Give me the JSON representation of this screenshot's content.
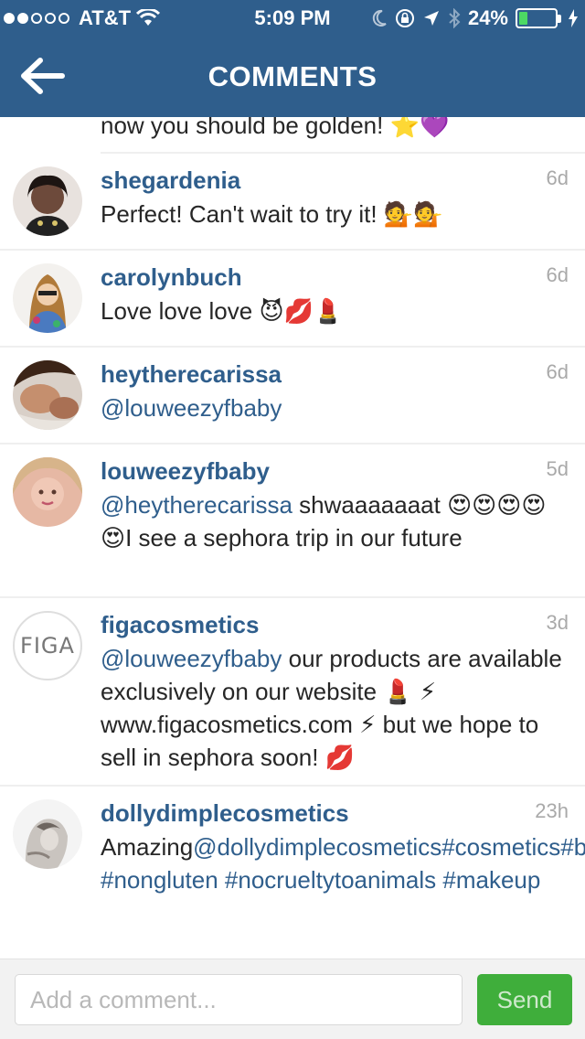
{
  "status_bar": {
    "carrier": "AT&T",
    "time": "5:09 PM",
    "battery_percent": "24%",
    "battery_level": 0.24,
    "signal_dots_filled": 2,
    "signal_dots_total": 5
  },
  "header": {
    "title": "COMMENTS",
    "back_icon": "back-arrow-icon"
  },
  "partial_comment": {
    "text": "now you should be golden! ⭐💜"
  },
  "comments": [
    {
      "username": "shegardenia",
      "time": "6d",
      "parts": [
        {
          "t": "Perfect! Can't wait to try it! 💁💁"
        }
      ]
    },
    {
      "username": "carolynbuch",
      "time": "6d",
      "parts": [
        {
          "t": "Love love love 😈💋💄"
        }
      ]
    },
    {
      "username": "heytherecarissa",
      "time": "6d",
      "parts": [
        {
          "t": "@louweezyfbaby",
          "mention": true
        }
      ]
    },
    {
      "username": "louweezyfbaby",
      "time": "5d",
      "parts": [
        {
          "t": "@heytherecarissa",
          "mention": true
        },
        {
          "t": " shwaaaaaaat 😍😍😍😍😍I see a sephora trip in our future"
        }
      ]
    },
    {
      "username": "figacosmetics",
      "time": "3d",
      "avatar_text": "FIGA",
      "parts": [
        {
          "t": "@louweezyfbaby",
          "mention": true
        },
        {
          "t": " our products are available exclusively on our website 💄 ⚡ www.figacosmetics.com ⚡ but we hope to sell in sephora soon! 💋"
        }
      ]
    },
    {
      "username": "dollydimplecosmetics",
      "time": "23h",
      "parts": [
        {
          "t": "Amazing"
        },
        {
          "t": "@dollydimplecosmetics#cosmetics#beauty#bride#lushlashes #nongluten #nocrueltytoanimals #makeup",
          "mention": true
        }
      ]
    }
  ],
  "footer": {
    "placeholder": "Add a comment...",
    "send_label": "Send"
  },
  "colors": {
    "header_bg": "#2f5e8c",
    "link": "#2f5e8c",
    "send_bg": "#3fae3b"
  }
}
